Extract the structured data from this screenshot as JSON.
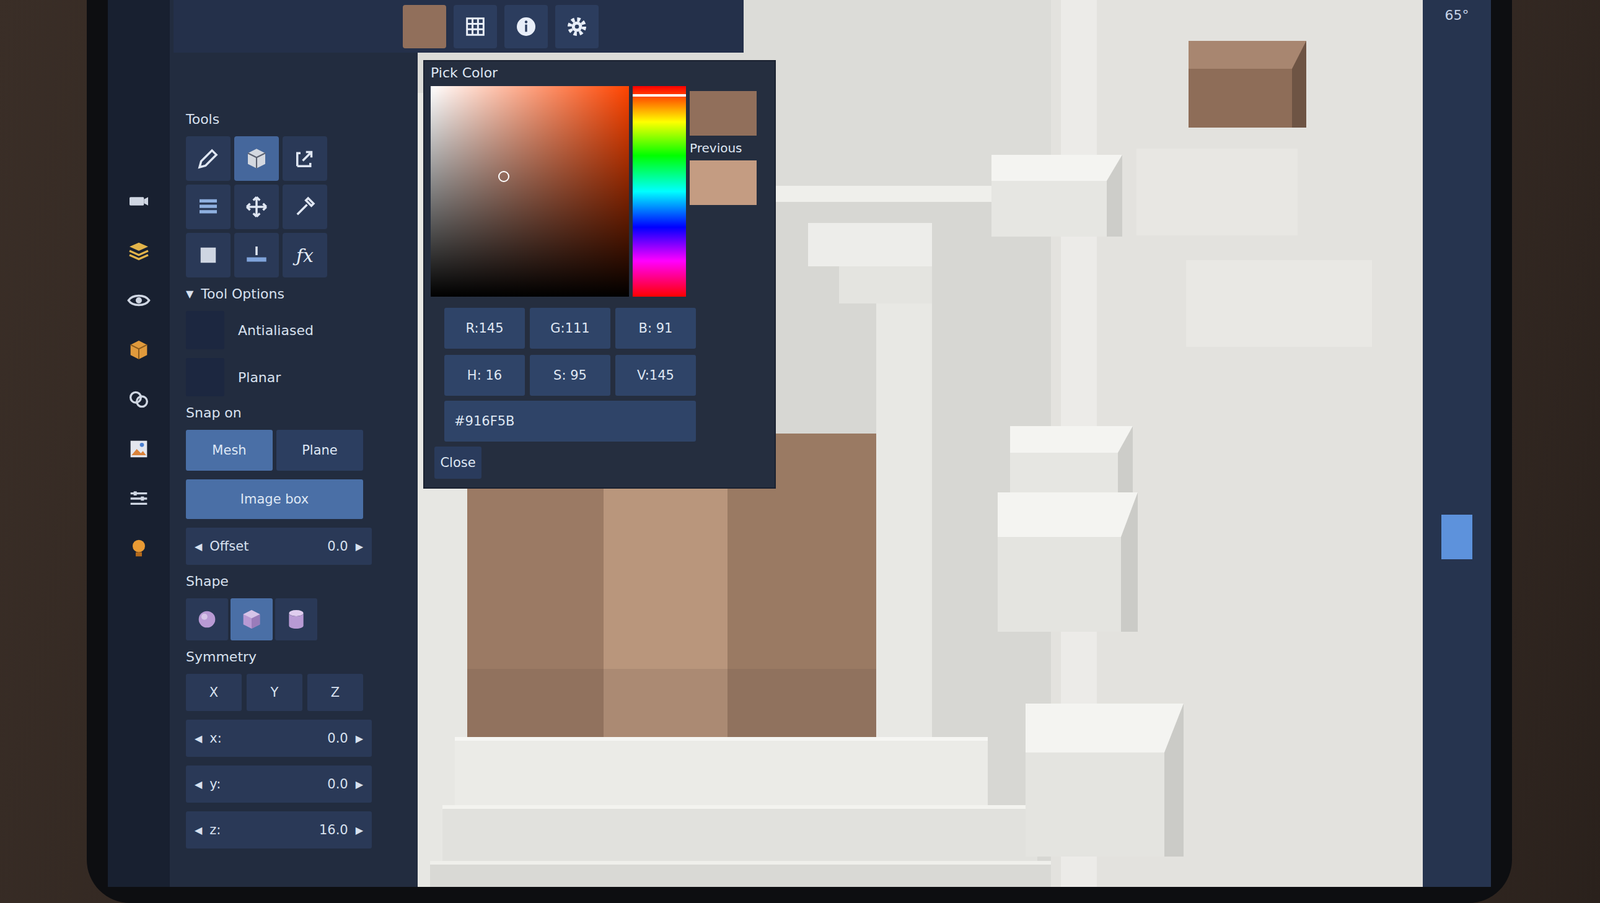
{
  "top_bar": {
    "current_color": "#916F5B"
  },
  "tools": {
    "title": "Tools",
    "items": [
      {
        "selected": false
      },
      {
        "selected": true
      },
      {
        "selected": false
      },
      {
        "selected": false
      },
      {
        "selected": false
      },
      {
        "selected": false
      },
      {
        "selected": false
      },
      {
        "selected": false
      },
      {
        "selected": false,
        "glyph": "ƒx"
      }
    ]
  },
  "tool_options": {
    "title": "Tool Options",
    "arrow": "▼",
    "expanded": true,
    "checkboxes": [
      {
        "label": "Antialiased",
        "checked": false
      },
      {
        "label": "Planar",
        "checked": false
      }
    ],
    "snap": {
      "title": "Snap on",
      "options": [
        {
          "label": "Mesh",
          "selected": true
        },
        {
          "label": "Plane",
          "selected": false
        }
      ],
      "image_box": {
        "label": "Image box",
        "on": true
      }
    },
    "offset": {
      "dec": "◀",
      "label": "Offset",
      "value": "0.0",
      "inc": "▶"
    },
    "shape": {
      "title": "Shape",
      "items": [
        {
          "kind": "sphere",
          "selected": false
        },
        {
          "kind": "cube",
          "selected": true
        },
        {
          "kind": "cylinder",
          "selected": false
        }
      ]
    },
    "symmetry": {
      "title": "Symmetry",
      "axes": [
        {
          "label": "X",
          "on": false
        },
        {
          "label": "Y",
          "on": false
        },
        {
          "label": "Z",
          "on": false
        }
      ],
      "fields": [
        {
          "dec": "◀",
          "label": "x:",
          "value": "0.0",
          "inc": "▶"
        },
        {
          "dec": "◀",
          "label": "y:",
          "value": "0.0",
          "inc": "▶"
        },
        {
          "dec": "◀",
          "label": "z:",
          "value": "16.0",
          "inc": "▶"
        }
      ]
    }
  },
  "color_picker": {
    "title": "Pick Color",
    "current_color": "#916F5B",
    "previous_label": "Previous",
    "previous_color": "#C49C82",
    "hue_level": 0.044,
    "saturation_level": 0.37,
    "value_level": 0.57,
    "fields": [
      "R:145",
      "G:111",
      "B: 91",
      "H: 16",
      "S: 95",
      "V:145"
    ],
    "hex": "#916F5B",
    "close": "Close"
  },
  "viewport": {
    "angle": "65°",
    "slider": {
      "level": 0.6
    }
  }
}
